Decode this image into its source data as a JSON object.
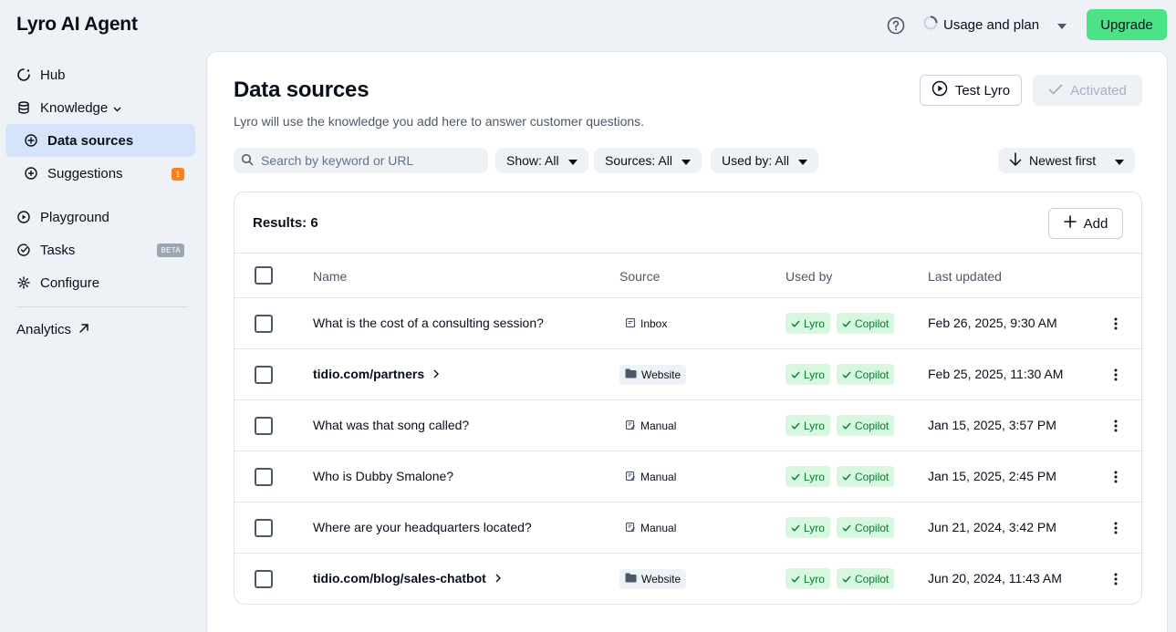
{
  "app": {
    "title": "Lyro AI Agent"
  },
  "topbar": {
    "usage_label": "Usage and plan",
    "upgrade_label": "Upgrade"
  },
  "sidebar": {
    "items": [
      {
        "label": "Hub",
        "icon": "hub-icon"
      },
      {
        "label": "Knowledge",
        "icon": "database-icon"
      },
      {
        "label": "Data sources",
        "icon": "data-sources-icon",
        "active": true
      },
      {
        "label": "Suggestions",
        "icon": "suggestions-icon",
        "badge": "1"
      },
      {
        "label": "Playground",
        "icon": "play-icon"
      },
      {
        "label": "Tasks",
        "icon": "tasks-icon",
        "badge": "BETA"
      },
      {
        "label": "Configure",
        "icon": "gear-icon"
      }
    ],
    "analytics_label": "Analytics"
  },
  "main": {
    "title": "Data sources",
    "subtitle": "Lyro will use the knowledge you add here to answer customer questions.",
    "test_label": "Test Lyro",
    "activated_label": "Activated",
    "search_placeholder": "Search by keyword or URL",
    "filters": {
      "show": "Show: All",
      "sources": "Sources: All",
      "used_by": "Used by: All"
    },
    "sort_label": "Newest first",
    "results_label": "Results: 6",
    "add_label": "Add",
    "columns": {
      "name": "Name",
      "source": "Source",
      "used_by": "Used by",
      "last_updated": "Last updated"
    },
    "used_by_tags": [
      "Lyro",
      "Copilot"
    ],
    "rows": [
      {
        "name": "What is the cost of a consulting session?",
        "source": "Inbox",
        "updated": "Feb 26, 2025, 9:30 AM"
      },
      {
        "name": "tidio.com/partners",
        "source": "Website",
        "updated": "Feb 25, 2025, 11:30 AM"
      },
      {
        "name": "What was that song called?",
        "source": "Manual",
        "updated": "Jan 15, 2025, 3:57 PM"
      },
      {
        "name": "Who is Dubby Smalone?",
        "source": "Manual",
        "updated": "Jan 15, 2025, 2:45 PM"
      },
      {
        "name": "Where are your headquarters located?",
        "source": "Manual",
        "updated": "Jun 21, 2024, 3:42 PM"
      },
      {
        "name": "tidio.com/blog/sales-chatbot",
        "source": "Website",
        "updated": "Jun 20, 2024, 11:43 AM"
      }
    ]
  },
  "colors": {
    "accent": "#4ce286",
    "active_nav": "#d6e4fb",
    "used_tag_bg": "#d7f8df",
    "used_tag_text": "#0a7a36",
    "badge_orange": "#ff7d1a"
  }
}
